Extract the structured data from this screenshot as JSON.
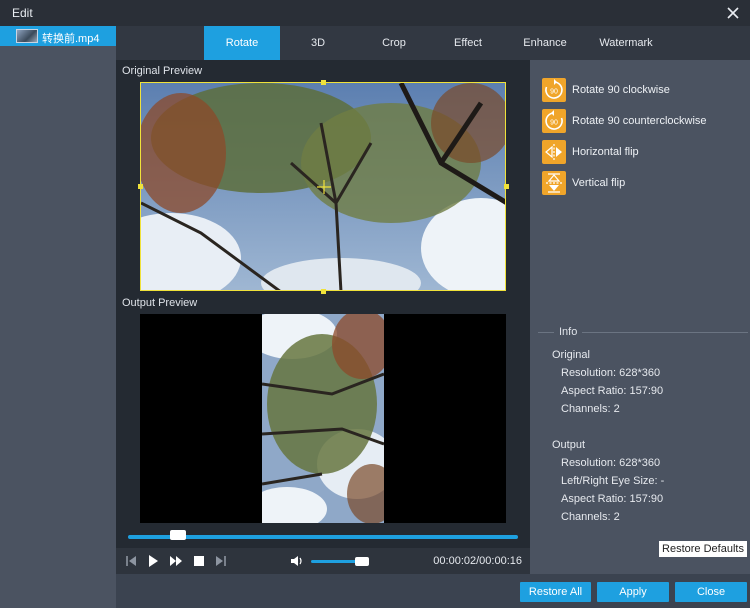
{
  "window": {
    "title": "Edit"
  },
  "file": {
    "name": "转换前.mp4"
  },
  "tabs": [
    {
      "label": "Rotate",
      "active": true
    },
    {
      "label": "3D"
    },
    {
      "label": "Crop"
    },
    {
      "label": "Effect"
    },
    {
      "label": "Enhance"
    },
    {
      "label": "Watermark"
    }
  ],
  "preview": {
    "original_label": "Original Preview",
    "output_label": "Output Preview"
  },
  "playback": {
    "time": "00:00:02/00:00:16",
    "progress": 0.125,
    "volume": 0.8
  },
  "rotate": {
    "items": [
      {
        "label": "Rotate 90 clockwise",
        "icon": "rotate-cw-icon",
        "badge": "90"
      },
      {
        "label": "Rotate 90 counterclockwise",
        "icon": "rotate-ccw-icon",
        "badge": "90"
      },
      {
        "label": "Horizontal flip",
        "icon": "flip-horizontal-icon"
      },
      {
        "label": "Vertical flip",
        "icon": "flip-vertical-icon"
      }
    ]
  },
  "info": {
    "title": "Info",
    "original_heading": "Original",
    "original": {
      "resolution": "Resolution: 628*360",
      "aspect": "Aspect Ratio: 157:90",
      "channels": "Channels: 2"
    },
    "output_heading": "Output",
    "output": {
      "resolution": "Resolution: 628*360",
      "eye_size": "Left/Right Eye Size: -",
      "aspect": "Aspect Ratio: 157:90",
      "channels": "Channels: 2"
    }
  },
  "buttons": {
    "restore_defaults": "Restore Defaults",
    "restore_all": "Restore All",
    "apply": "Apply",
    "close": "Close"
  },
  "colors": {
    "accent": "#1ea0e0",
    "icon": "#f0a52a",
    "crop_frame": "#f0e23a"
  }
}
